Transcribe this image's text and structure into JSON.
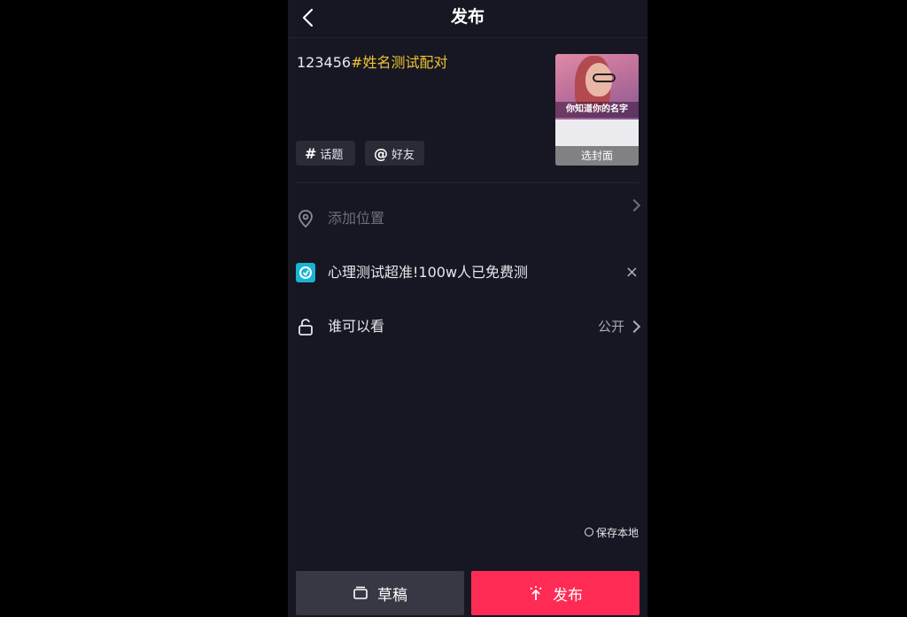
{
  "header": {
    "title": "发布"
  },
  "caption": {
    "prefix": "123456",
    "hashtag": "#姓名测试配对"
  },
  "chips": {
    "topic": {
      "glyph": "#",
      "label": "话题"
    },
    "friend": {
      "glyph": "@",
      "label": "好友"
    }
  },
  "cover": {
    "overlay_text": "你知道你的名字",
    "label": "选封面"
  },
  "rows": {
    "location": {
      "label": "添加位置",
      "icon": "location-pin-icon"
    },
    "promo": {
      "label": "心理测试超准!100w人已免费测",
      "icon": "mini-app-link-icon",
      "close": "×"
    },
    "privacy": {
      "label": "谁可以看",
      "value": "公开",
      "icon": "unlock-icon"
    }
  },
  "save_local": {
    "label": "保存本地"
  },
  "buttons": {
    "draft": "草稿",
    "publish": "发布"
  },
  "colors": {
    "background": "#161722",
    "accent_red": "#fe2c55",
    "hashtag_yellow": "#f1c232",
    "promo_cyan": "#19b4d3"
  }
}
